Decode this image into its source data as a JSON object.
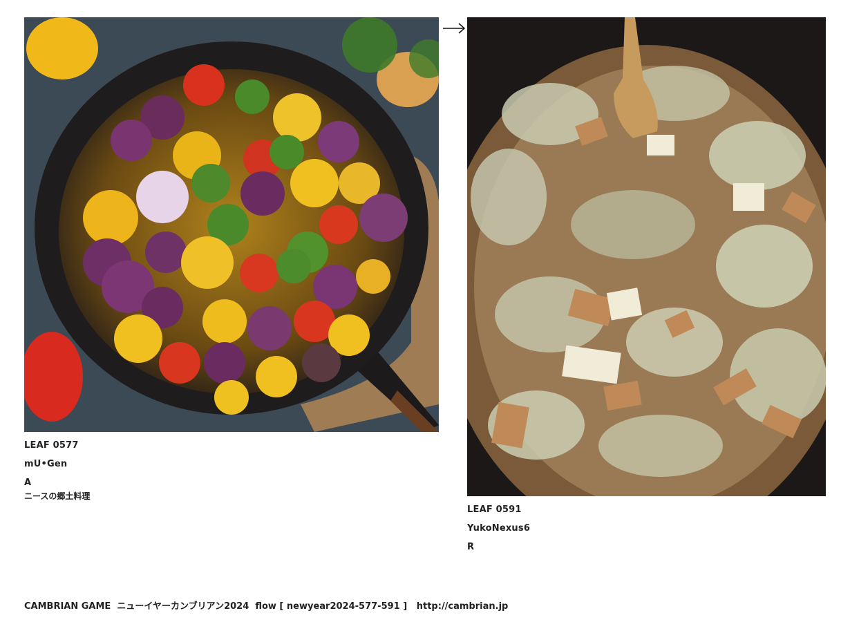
{
  "leaves": [
    {
      "id": "LEAF 0577",
      "author": "mU•Gen",
      "grade": "A",
      "caption": "ニースの郷土料理",
      "photo_subject": "ratatouille-vegetables-in-cast-iron-skillet"
    },
    {
      "id": "LEAF 0591",
      "author": "YukoNexus6",
      "grade": "R",
      "caption": "",
      "photo_subject": "cabbage-and-tofu-stew-in-pot"
    }
  ],
  "arrow_icon": "right-arrow-icon",
  "footer": {
    "brand": "CAMBRIAN GAME",
    "event": "ニューイヤーカンブリアン2024",
    "flow": "flow [ newyear2024-577-591 ]",
    "url": "http://cambrian.jp"
  }
}
